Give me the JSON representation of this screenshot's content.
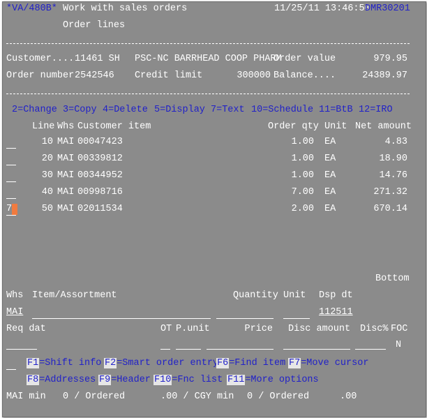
{
  "header": {
    "program": "*VA/480B*",
    "title": "Work with sales orders",
    "subtitle": "Order lines",
    "datetime": "11/25/11 13:46:50",
    "device": "DMR30201"
  },
  "info": {
    "customer_label": "Customer....",
    "customer_no": "11461 SH",
    "customer_name": "PSC-NC BARRHEAD COOP PHARM",
    "order_value_label": "Order value",
    "order_value": "979.95",
    "order_number_label": "Order number",
    "order_number": "2542546",
    "credit_limit_label": "Credit limit",
    "credit_limit": "300000",
    "balance_label": "Balance....",
    "balance": "24389.97"
  },
  "options": {
    "change": "2=Change",
    "copy": "3=Copy",
    "delete": "4=Delete",
    "display": "5=Display",
    "text": "7=Text",
    "schedule": "10=Schedule",
    "btb": "11=BtB",
    "iro": "12=IRO"
  },
  "columns": {
    "line": "Line",
    "whs": "Whs",
    "item": "Customer item",
    "qty": "Order qty",
    "unit": "Unit",
    "net": "Net amount"
  },
  "rows": [
    {
      "opt": "",
      "line": "10",
      "whs": "MAI",
      "item": "00047423",
      "qty": "1.00",
      "unit": "EA",
      "net": "4.83"
    },
    {
      "opt": "",
      "line": "20",
      "whs": "MAI",
      "item": "00339812",
      "qty": "1.00",
      "unit": "EA",
      "net": "18.90"
    },
    {
      "opt": "",
      "line": "30",
      "whs": "MAI",
      "item": "00344952",
      "qty": "1.00",
      "unit": "EA",
      "net": "14.76"
    },
    {
      "opt": "",
      "line": "40",
      "whs": "MAI",
      "item": "00998716",
      "qty": "7.00",
      "unit": "EA",
      "net": "271.32"
    },
    {
      "opt": "7",
      "line": "50",
      "whs": "MAI",
      "item": "02011534",
      "qty": "2.00",
      "unit": "EA",
      "net": "670.14"
    }
  ],
  "bottom_marker": "Bottom",
  "entry": {
    "whs_label": "Whs",
    "item_label": "Item/Assortment",
    "quantity_label": "Quantity",
    "unit_label": "Unit",
    "dsp_label": "Dsp dt",
    "whs_value": "MAI",
    "dsp_value": "112511",
    "req_label": "Req dat",
    "ot_label": "OT",
    "punit_label": "P.unit",
    "price_label": "Price",
    "disc_amount_label": "Disc amount",
    "disc_pct_label": "Disc%",
    "foc_label": "FOC",
    "foc_value": "N"
  },
  "fkeys": {
    "f1": {
      "key": "F1",
      "text": "=Shift info"
    },
    "f2": {
      "key": "F2",
      "text": "=Smart order entry"
    },
    "f6": {
      "key": "F6",
      "text": "=Find item"
    },
    "f7": {
      "key": "F7",
      "text": "=Move cursor"
    },
    "f8": {
      "key": "F8",
      "text": "=Addresses"
    },
    "f9": {
      "key": "F9",
      "text": "=Header"
    },
    "f10": {
      "key": "F10",
      "text": "=Fnc list"
    },
    "f11": {
      "key": "F11",
      "text": "=More options"
    }
  },
  "status": {
    "mai_label": "MAI min",
    "mai_value": "0 / Ordered",
    "mai_amount": ".00 / CGY min",
    "cgy_value": "0 / Ordered",
    "cgy_amount": ".00"
  },
  "colors": {
    "background": "#8b8b8b",
    "text": "#ffffff",
    "highlight": "#2121c8",
    "cursor": "#f07b3f"
  }
}
